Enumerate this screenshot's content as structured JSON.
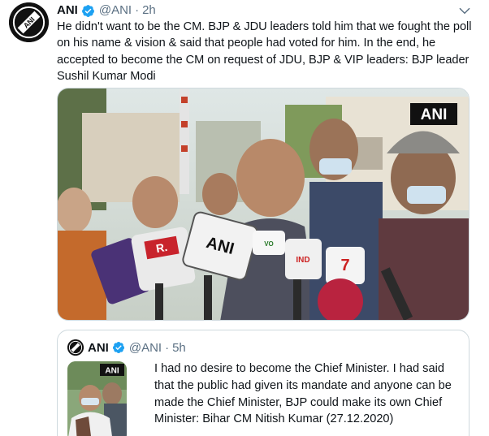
{
  "tweet": {
    "name": "ANI",
    "handle": "@ANI",
    "separator": "·",
    "time": "2h",
    "text": "He didn't want to be the CM. BJP & JDU leaders told him that we fought the poll on his name & vision & said that people had voted for him. In the end, he accepted to become the CM on request of JDU, BJP & VIP leaders: BJP leader Sushil Kumar Modi",
    "photo_watermark": "ANI",
    "mic_labels": [
      "ANI",
      "R.",
      "IND",
      "7",
      "VO"
    ]
  },
  "quote": {
    "name": "ANI",
    "handle": "@ANI",
    "separator": "·",
    "time": "5h",
    "thumb_watermark": "ANI",
    "text": "I had no desire to become the Chief Minister. I had said that the public had given its mandate and anyone can be made the Chief Minister, BJP could make its own Chief Minister: Bihar CM Nitish Kumar (27.12.2020)",
    "ellipsis": "..."
  },
  "colors": {
    "verified_blue": "#1da1f2",
    "secondary_text": "#5b7083",
    "border": "#cfd9de"
  },
  "icons": {
    "avatar": "ani-logo-icon",
    "verified": "verified-badge-icon",
    "caret": "chevron-down-icon"
  }
}
